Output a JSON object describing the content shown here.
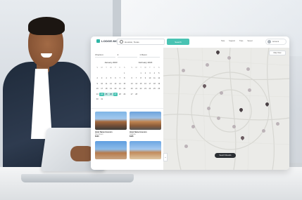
{
  "app": {
    "logo_text": "LODGE.MO",
    "search_value": "Houston, Texas",
    "search_button": "Search",
    "nav": [
      "Help",
      "Support",
      "Trips",
      "Saved"
    ],
    "account_label": "Account"
  },
  "filters": {
    "checkin": "Check-in",
    "guests": "2",
    "rooms": "1 Room"
  },
  "calendar": {
    "left_month": "January 2023",
    "right_month": "February 2023",
    "dow": [
      "S",
      "M",
      "T",
      "W",
      "T",
      "F",
      "S"
    ],
    "left_days": [
      "",
      "",
      "",
      "",
      "",
      "",
      "1",
      "2",
      "3",
      "4",
      "5",
      "6",
      "7",
      "8",
      "9",
      "10",
      "11",
      "12",
      "13",
      "14",
      "15",
      "16",
      "17",
      "18",
      "19",
      "20",
      "21",
      "22",
      "23",
      "24",
      "25",
      "26",
      "27",
      "28",
      "29",
      "30",
      "31"
    ],
    "right_days": [
      "",
      "",
      "1",
      "2",
      "3",
      "4",
      "5",
      "6",
      "7",
      "8",
      "9",
      "10",
      "11",
      "12",
      "13",
      "14",
      "15",
      "16",
      "17",
      "18",
      "19",
      "20",
      "21",
      "22",
      "23",
      "24",
      "25",
      "26",
      "27",
      "28"
    ],
    "selected_start": "24",
    "selected_end": "27",
    "range": [
      "25",
      "26"
    ]
  },
  "cards": [
    {
      "title": "Hotel Name Houston",
      "sub": "Downtown",
      "price": "$120"
    },
    {
      "title": "Hotel Name Houston",
      "sub": "Galleria",
      "price": "$135"
    },
    {
      "title": "Hotel Name Houston",
      "sub": "Midtown",
      "price": "$98"
    },
    {
      "title": "Hotel Name Houston",
      "sub": "Uptown",
      "price": "$142"
    }
  ],
  "map": {
    "top_button": "Map View",
    "bottom_pill": "Search Results",
    "zoom": "+"
  },
  "colors": {
    "accent": "#49c3b3",
    "map_bg": "#ebebe8"
  }
}
